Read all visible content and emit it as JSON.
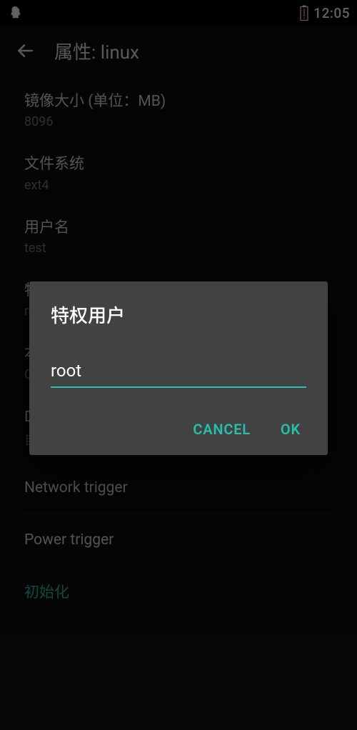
{
  "status_bar": {
    "time": "12:05"
  },
  "app_bar": {
    "title": "属性: linux"
  },
  "settings": [
    {
      "title": "镜像大小 (单位：MB)",
      "sub": "8096"
    },
    {
      "title": "文件系统",
      "sub": "ext4"
    },
    {
      "title": "用户名",
      "sub": "test"
    },
    {
      "title": "特权用户",
      "sub": "root"
    },
    {
      "title": "本地化",
      "sub": "C"
    },
    {
      "title": "DNS",
      "sub": "自动"
    },
    {
      "title": "Network trigger"
    },
    {
      "title": "Power trigger"
    },
    {
      "title": "初始化",
      "action": true
    }
  ],
  "dialog": {
    "title": "特权用户",
    "input_value": "root",
    "cancel": "CANCEL",
    "ok": "OK"
  }
}
